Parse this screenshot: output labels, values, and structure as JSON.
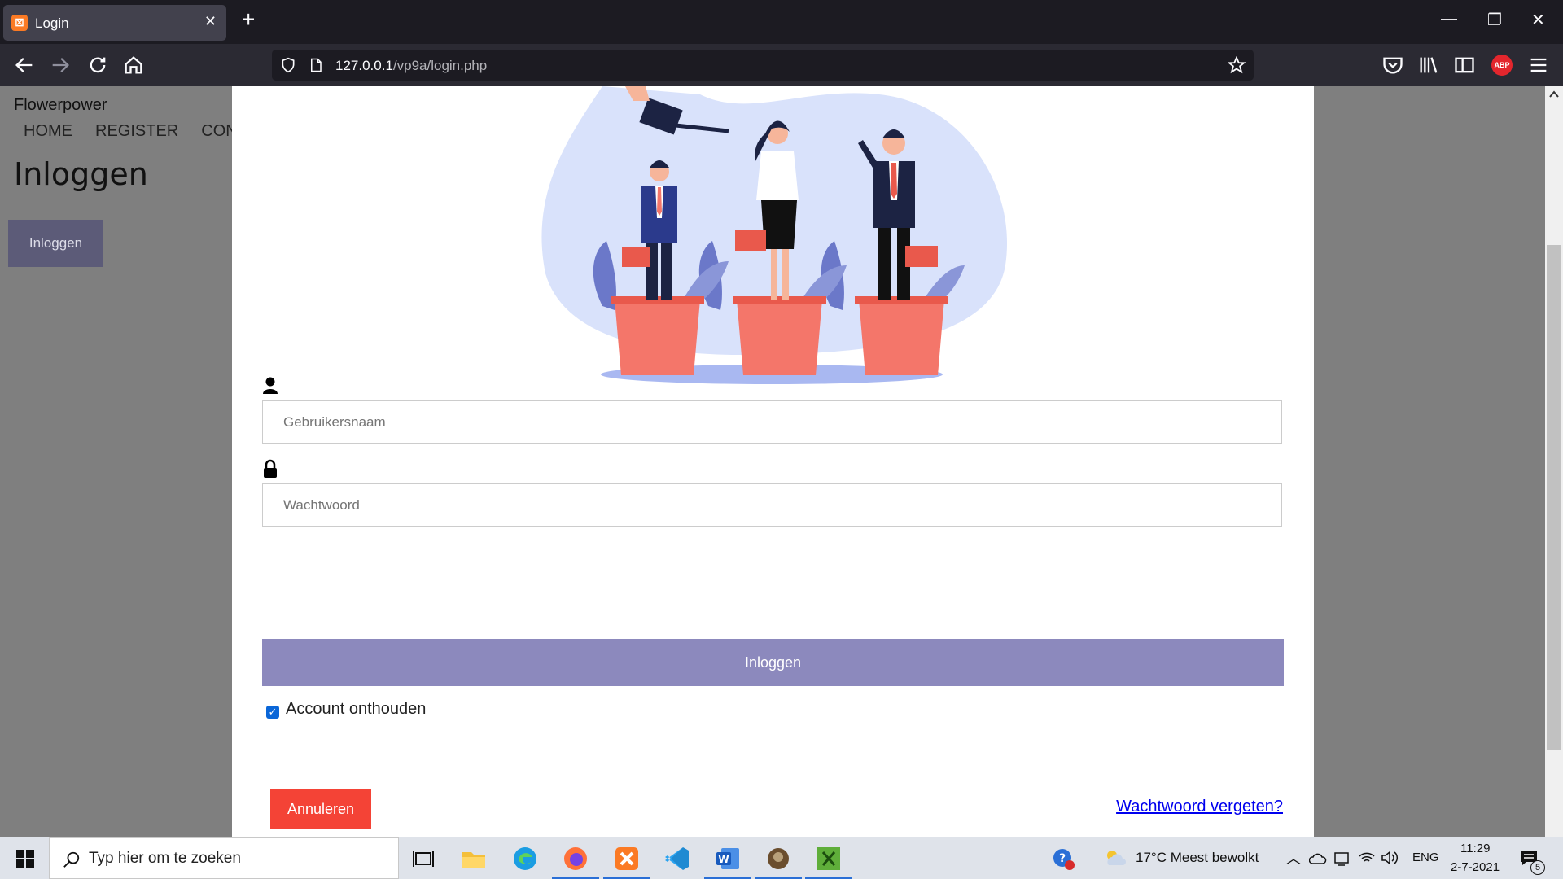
{
  "browser": {
    "tab_title": "Login",
    "url_host": "127.0.0.1",
    "url_path": "/vp9a/login.php",
    "abp_label": "ABP"
  },
  "background_page": {
    "brand": "Flowerpower",
    "menu": [
      "HOME",
      "REGISTER",
      "CONT"
    ],
    "heading": "Inloggen",
    "button": "Inloggen"
  },
  "modal": {
    "username_placeholder": "Gebruikersnaam",
    "password_placeholder": "Wachtwoord",
    "login_button": "Inloggen",
    "remember_label": "Account onthouden",
    "remember_checked": true,
    "cancel_button": "Annuleren",
    "forgot_link": "Wachtwoord vergeten?"
  },
  "taskbar": {
    "search_placeholder": "Typ hier om te zoeken",
    "weather": "17°C  Meest bewolkt",
    "language": "ENG",
    "time": "11:29",
    "date": "2-7-2021",
    "notifications_count": "5"
  },
  "colors": {
    "primary": "#8c89bd",
    "danger": "#f44336",
    "pot": "#f4766a",
    "plant_blob": "#d9e2fb"
  }
}
